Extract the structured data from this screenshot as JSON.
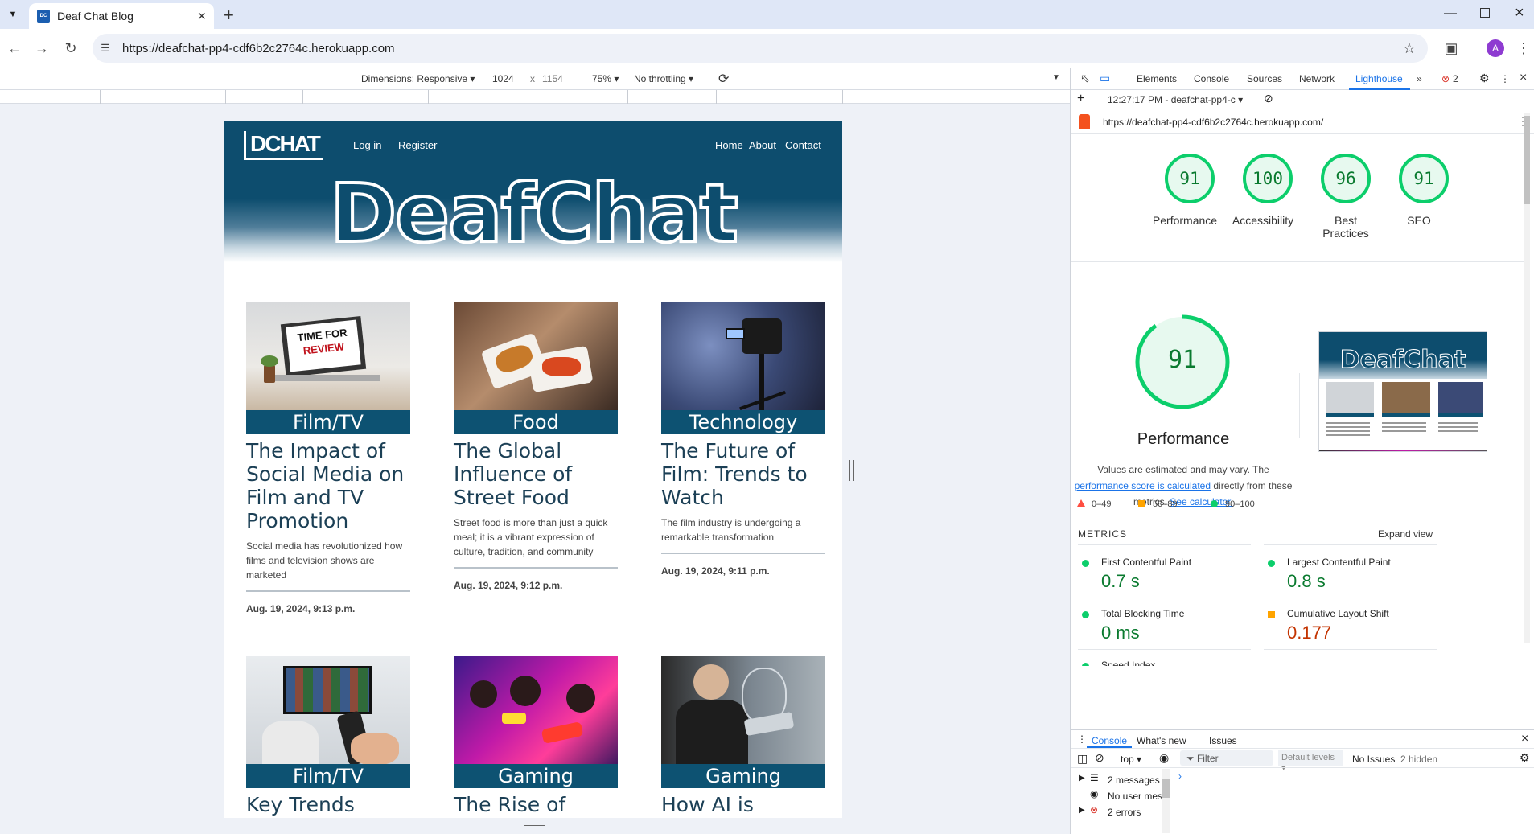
{
  "browser": {
    "tab_title": "Deaf Chat Blog",
    "url": "https://deafchat-pp4-cdf6b2c2764c.herokuapp.com",
    "profile_initial": "A"
  },
  "device_toolbar": {
    "dimensions_label": "Dimensions: Responsive",
    "width": "1024",
    "height": "1154",
    "times": "x",
    "zoom": "75%",
    "throttling": "No throttling"
  },
  "site": {
    "logo": "DCHAT",
    "nav_left": [
      "Log in",
      "Register"
    ],
    "nav_right": [
      "Home",
      "About",
      "Contact"
    ],
    "hero_title": "DeafChat",
    "posts": [
      {
        "category": "Film/TV",
        "title": "The Impact of Social Media on Film and TV Promotion",
        "excerpt": "Social media has revolutionized how films and television shows are marketed",
        "date": "Aug. 19, 2024, 9:13 p.m."
      },
      {
        "category": "Food",
        "title": "The Global Influence of Street Food",
        "excerpt": "Street food is more than just a quick meal; it is a vibrant expression of culture, tradition, and community",
        "date": "Aug. 19, 2024, 9:12 p.m."
      },
      {
        "category": "Technology",
        "title": "The Future of Film: Trends to Watch",
        "excerpt": "The film industry is undergoing a remarkable transformation",
        "date": "Aug. 19, 2024, 9:11 p.m."
      },
      {
        "category": "Film/TV",
        "title": "Key Trends Shaping the TV"
      },
      {
        "category": "Gaming",
        "title": "The Rise of Mobile Gaming"
      },
      {
        "category": "Gaming",
        "title": "How AI is Transforming"
      }
    ],
    "review_sign": [
      "TIME FOR",
      "REVIEW"
    ]
  },
  "devtools": {
    "tabs": [
      "Elements",
      "Console",
      "Sources",
      "Network",
      "Lighthouse"
    ],
    "active_tab": "Lighthouse",
    "error_count": "2",
    "report_label": "12:27:17 PM - deafchat-pp4-c",
    "report_url": "https://deafchat-pp4-cdf6b2c2764c.herokuapp.com/",
    "scores": [
      {
        "value": 91,
        "label": "Performance"
      },
      {
        "value": 100,
        "label": "Accessibility"
      },
      {
        "value": 96,
        "label": "Best Practices"
      },
      {
        "value": 91,
        "label": "SEO"
      }
    ],
    "main_score": 91,
    "main_label": "Performance",
    "note_pre": "Values are estimated and may vary. The",
    "note_link1": "performance score is calculated",
    "note_mid": "directly from these metrics.",
    "note_link2": "See calculator.",
    "legend": [
      "0–49",
      "50–89",
      "90–100"
    ],
    "metrics_header": "METRICS",
    "expand_view": "Expand view",
    "metrics": [
      {
        "label": "First Contentful Paint",
        "value": "0.7 s",
        "status": "good"
      },
      {
        "label": "Largest Contentful Paint",
        "value": "0.8 s",
        "status": "good"
      },
      {
        "label": "Total Blocking Time",
        "value": "0 ms",
        "status": "good"
      },
      {
        "label": "Cumulative Layout Shift",
        "value": "0.177",
        "status": "average"
      },
      {
        "label": "Speed Index"
      }
    ],
    "thumb_title": "DeafChat",
    "console": {
      "tabs": [
        "Console",
        "What's new",
        "Issues"
      ],
      "context": "top",
      "filter_placeholder": "Filter",
      "levels": "Default levels",
      "issues": "No Issues",
      "hidden": "2 hidden",
      "rows": [
        "2 messages",
        "No user mes...",
        "2 errors"
      ]
    },
    "colors": {
      "good": "#0cce6b",
      "average": "#ffa400",
      "bad": "#ff4e42",
      "good_text": "#0a7a2f",
      "avg_text": "#c33300"
    }
  }
}
